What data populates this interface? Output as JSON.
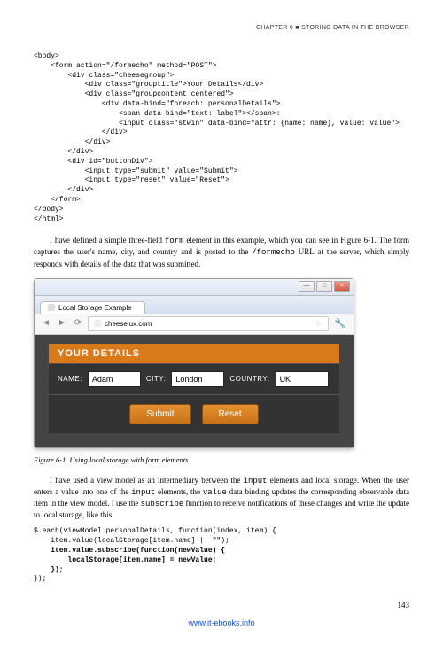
{
  "header": {
    "chapter_line": "CHAPTER 6 ■ STORING DATA IN THE BROWSER"
  },
  "code_listing_top": "<body>\n    <form action=\"/formecho\" method=\"POST\">\n        <div class=\"cheesegroup\">\n            <div class=\"grouptitle\">Your Details</div>\n            <div class=\"groupcontent centered\">\n                <div data-bind=\"foreach: personalDetails\">\n                    <span data-bind=\"text: label\"></span>:\n                    <input class=\"stwin\" data-bind=\"attr: {name: name}, value: value\">\n                </div>\n            </div>\n        </div>\n        <div id=\"buttonDiv\">\n            <input type=\"submit\" value=\"Submit\">\n            <input type=\"reset\" value=\"Reset\">\n        </div>\n    </form>\n</body>\n</html>",
  "para1": {
    "text_a": "I have defined a simple three-field ",
    "mono_a": "form",
    "text_b": " element in this example, which you can see in Figure 6-1. The form captures the user's name, city, and country and is posted to the ",
    "mono_b": "/formecho",
    "text_c": " URL at the server, which simply responds with details of the data that was submitted."
  },
  "browser": {
    "tab_title": "Local Storage Example",
    "url": "cheeselux.com",
    "section_title": "YOUR DETAILS",
    "labels": {
      "name": "NAME:",
      "city": "CITY:",
      "country": "COUNTRY:"
    },
    "values": {
      "name": "Adam",
      "city": "London",
      "country": "UK"
    },
    "buttons": {
      "submit": "Submit",
      "reset": "Reset"
    },
    "win": {
      "min": "—",
      "max": "□",
      "close": "×"
    }
  },
  "figure_caption": "Figure 6-1. Using local storage with form elements",
  "para2": {
    "text_a": "I have used a view model as an intermediary between the ",
    "mono_a": "input",
    "text_b": " elements and local storage. When the user enters a value into one of the ",
    "mono_b": "input",
    "text_c": " elements, the ",
    "mono_c": "value",
    "text_d": " data binding updates the corresponding observable data item in the view model. I use the ",
    "mono_d": "subscribe",
    "text_e": " function to receive notifications of these changes and write the update to local storage, like this:"
  },
  "code_listing_bottom": {
    "l1": "$.each(viewModel.personalDetails, function(index, item) {",
    "l2": "    item.value(localStorage[item.name] || \"\");",
    "l3": "    item.value.subscribe(function(newValue) {",
    "l4": "        localStorage[item.name] = newValue;",
    "l5": "    });",
    "l6": "});"
  },
  "page_number": "143",
  "footer_link": "www.it-ebooks.info"
}
